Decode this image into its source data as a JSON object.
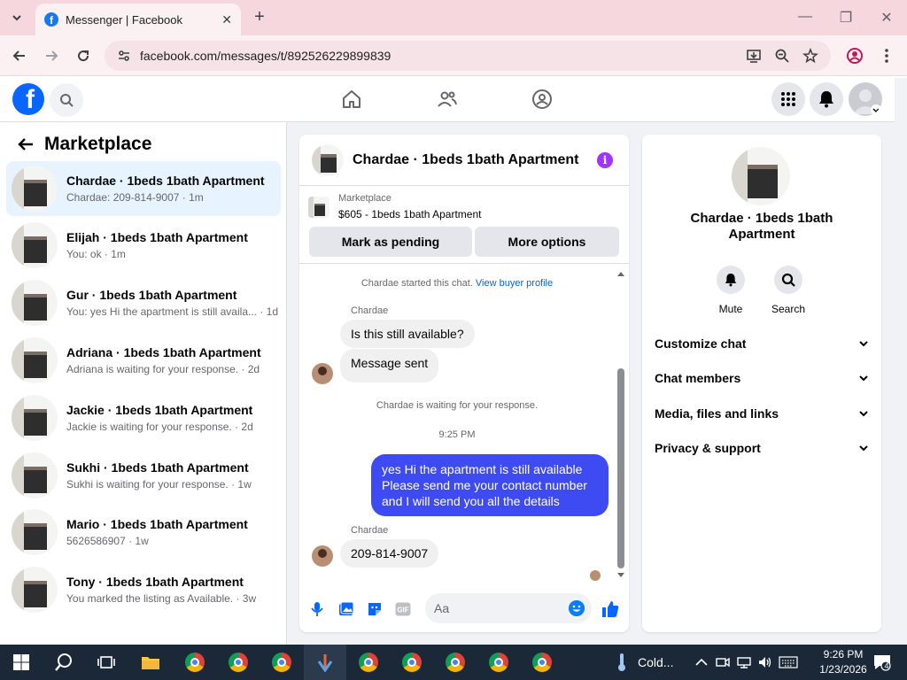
{
  "browser": {
    "tab_title": "Messenger | Facebook",
    "url": "facebook.com/messages/t/892526229899839"
  },
  "sidebar": {
    "title": "Marketplace",
    "conversations": [
      {
        "name": "Chardae · 1beds 1bath Apartment",
        "preview": "Chardae: 209-814-9007 · 1m",
        "active": true
      },
      {
        "name": "Elijah · 1beds 1bath Apartment",
        "preview": "You: ok · 1m"
      },
      {
        "name": "Gur · 1beds 1bath Apartment",
        "preview": "You: yes Hi the apartment is still availa... · 1d"
      },
      {
        "name": "Adriana · 1beds 1bath Apartment",
        "preview": "Adriana is waiting for your response. · 2d"
      },
      {
        "name": "Jackie · 1beds 1bath Apartment",
        "preview": "Jackie is waiting for your response. · 2d"
      },
      {
        "name": "Sukhi · 1beds 1bath Apartment",
        "preview": "Sukhi is waiting for your response. · 1w"
      },
      {
        "name": "Mario · 1beds 1bath Apartment",
        "preview": "5626586907 · 1w"
      },
      {
        "name": "Tony · 1beds 1bath Apartment",
        "preview": "You marked the listing as Available. · 3w"
      }
    ]
  },
  "chat": {
    "title": "Chardae · 1beds 1bath Apartment",
    "listing_category": "Marketplace",
    "listing_title": "$605 - 1beds 1bath Apartment",
    "btn_pending": "Mark as pending",
    "btn_more": "More options",
    "started_text": "Chardae started this chat.",
    "buyer_link": "View buyer profile",
    "sender1": "Chardae",
    "msg1": "Is this still available?",
    "msg2": "Message sent",
    "waiting": "Chardae is waiting for your response.",
    "time": "9:25 PM",
    "out_msg": "yes Hi the apartment is still available Please send me your contact number and I will send you all the details",
    "sender2": "Chardae",
    "msg3": "209-814-9007",
    "composer_placeholder": "Aa"
  },
  "details": {
    "title": "Chardae · 1beds 1bath Apartment",
    "mute": "Mute",
    "search": "Search",
    "sections": [
      "Customize chat",
      "Chat members",
      "Media, files and links",
      "Privacy & support"
    ]
  },
  "taskbar": {
    "weather": "Cold...",
    "time": "9:26 PM",
    "date": "1/23/2026",
    "notifications": "4"
  },
  "colors": {
    "accent": "#0866ff",
    "out_bubble": "#3e4af2",
    "info": "#a033ff"
  }
}
